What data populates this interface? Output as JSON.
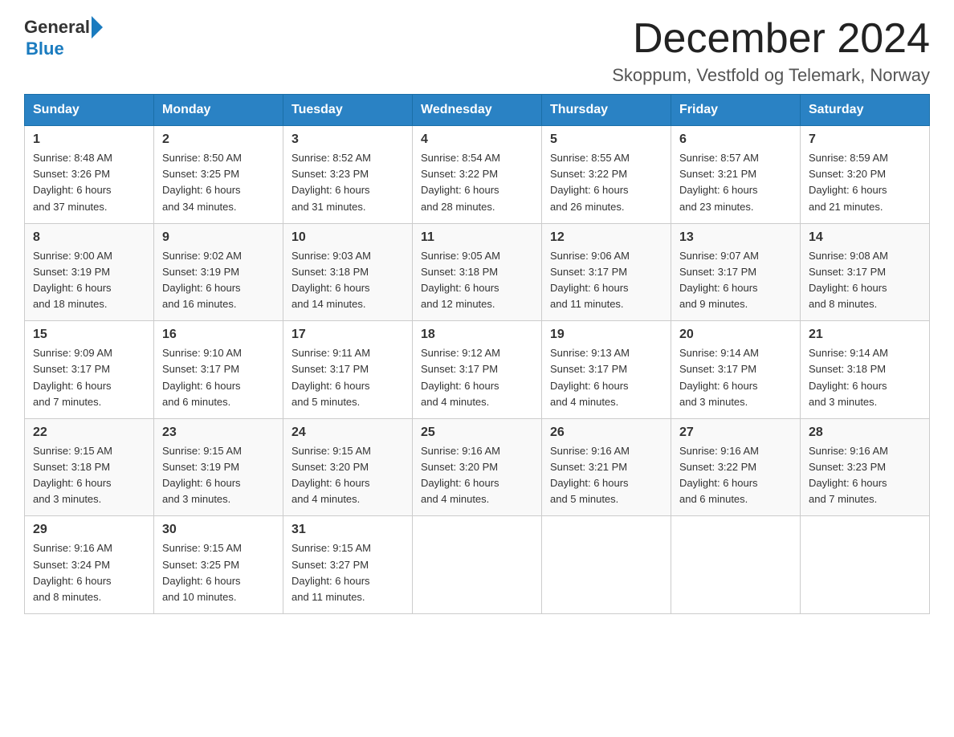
{
  "header": {
    "logo_general": "General",
    "logo_blue": "Blue",
    "title": "December 2024",
    "location": "Skoppum, Vestfold og Telemark, Norway"
  },
  "weekdays": [
    "Sunday",
    "Monday",
    "Tuesday",
    "Wednesday",
    "Thursday",
    "Friday",
    "Saturday"
  ],
  "weeks": [
    [
      {
        "day": "1",
        "sunrise": "8:48 AM",
        "sunset": "3:26 PM",
        "daylight": "6 hours and 37 minutes."
      },
      {
        "day": "2",
        "sunrise": "8:50 AM",
        "sunset": "3:25 PM",
        "daylight": "6 hours and 34 minutes."
      },
      {
        "day": "3",
        "sunrise": "8:52 AM",
        "sunset": "3:23 PM",
        "daylight": "6 hours and 31 minutes."
      },
      {
        "day": "4",
        "sunrise": "8:54 AM",
        "sunset": "3:22 PM",
        "daylight": "6 hours and 28 minutes."
      },
      {
        "day": "5",
        "sunrise": "8:55 AM",
        "sunset": "3:22 PM",
        "daylight": "6 hours and 26 minutes."
      },
      {
        "day": "6",
        "sunrise": "8:57 AM",
        "sunset": "3:21 PM",
        "daylight": "6 hours and 23 minutes."
      },
      {
        "day": "7",
        "sunrise": "8:59 AM",
        "sunset": "3:20 PM",
        "daylight": "6 hours and 21 minutes."
      }
    ],
    [
      {
        "day": "8",
        "sunrise": "9:00 AM",
        "sunset": "3:19 PM",
        "daylight": "6 hours and 18 minutes."
      },
      {
        "day": "9",
        "sunrise": "9:02 AM",
        "sunset": "3:19 PM",
        "daylight": "6 hours and 16 minutes."
      },
      {
        "day": "10",
        "sunrise": "9:03 AM",
        "sunset": "3:18 PM",
        "daylight": "6 hours and 14 minutes."
      },
      {
        "day": "11",
        "sunrise": "9:05 AM",
        "sunset": "3:18 PM",
        "daylight": "6 hours and 12 minutes."
      },
      {
        "day": "12",
        "sunrise": "9:06 AM",
        "sunset": "3:17 PM",
        "daylight": "6 hours and 11 minutes."
      },
      {
        "day": "13",
        "sunrise": "9:07 AM",
        "sunset": "3:17 PM",
        "daylight": "6 hours and 9 minutes."
      },
      {
        "day": "14",
        "sunrise": "9:08 AM",
        "sunset": "3:17 PM",
        "daylight": "6 hours and 8 minutes."
      }
    ],
    [
      {
        "day": "15",
        "sunrise": "9:09 AM",
        "sunset": "3:17 PM",
        "daylight": "6 hours and 7 minutes."
      },
      {
        "day": "16",
        "sunrise": "9:10 AM",
        "sunset": "3:17 PM",
        "daylight": "6 hours and 6 minutes."
      },
      {
        "day": "17",
        "sunrise": "9:11 AM",
        "sunset": "3:17 PM",
        "daylight": "6 hours and 5 minutes."
      },
      {
        "day": "18",
        "sunrise": "9:12 AM",
        "sunset": "3:17 PM",
        "daylight": "6 hours and 4 minutes."
      },
      {
        "day": "19",
        "sunrise": "9:13 AM",
        "sunset": "3:17 PM",
        "daylight": "6 hours and 4 minutes."
      },
      {
        "day": "20",
        "sunrise": "9:14 AM",
        "sunset": "3:17 PM",
        "daylight": "6 hours and 3 minutes."
      },
      {
        "day": "21",
        "sunrise": "9:14 AM",
        "sunset": "3:18 PM",
        "daylight": "6 hours and 3 minutes."
      }
    ],
    [
      {
        "day": "22",
        "sunrise": "9:15 AM",
        "sunset": "3:18 PM",
        "daylight": "6 hours and 3 minutes."
      },
      {
        "day": "23",
        "sunrise": "9:15 AM",
        "sunset": "3:19 PM",
        "daylight": "6 hours and 3 minutes."
      },
      {
        "day": "24",
        "sunrise": "9:15 AM",
        "sunset": "3:20 PM",
        "daylight": "6 hours and 4 minutes."
      },
      {
        "day": "25",
        "sunrise": "9:16 AM",
        "sunset": "3:20 PM",
        "daylight": "6 hours and 4 minutes."
      },
      {
        "day": "26",
        "sunrise": "9:16 AM",
        "sunset": "3:21 PM",
        "daylight": "6 hours and 5 minutes."
      },
      {
        "day": "27",
        "sunrise": "9:16 AM",
        "sunset": "3:22 PM",
        "daylight": "6 hours and 6 minutes."
      },
      {
        "day": "28",
        "sunrise": "9:16 AM",
        "sunset": "3:23 PM",
        "daylight": "6 hours and 7 minutes."
      }
    ],
    [
      {
        "day": "29",
        "sunrise": "9:16 AM",
        "sunset": "3:24 PM",
        "daylight": "6 hours and 8 minutes."
      },
      {
        "day": "30",
        "sunrise": "9:15 AM",
        "sunset": "3:25 PM",
        "daylight": "6 hours and 10 minutes."
      },
      {
        "day": "31",
        "sunrise": "9:15 AM",
        "sunset": "3:27 PM",
        "daylight": "6 hours and 11 minutes."
      },
      null,
      null,
      null,
      null
    ]
  ]
}
